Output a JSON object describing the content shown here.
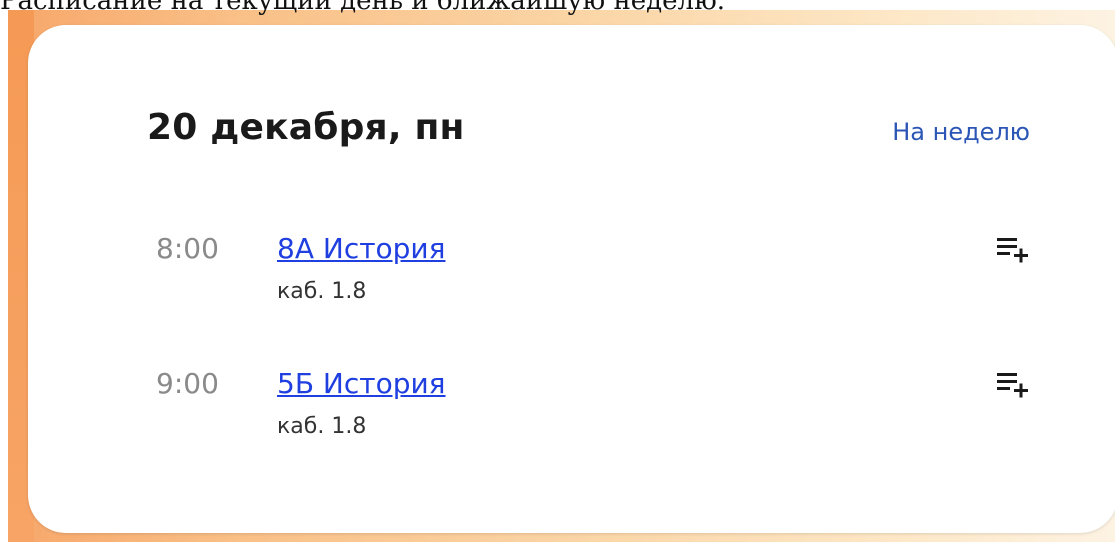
{
  "caption": "Расписание на текущий день и ближайшую неделю.",
  "schedule": {
    "date": "20 декабря, пн",
    "week_link": "На неделю",
    "lessons": [
      {
        "time": "8:00",
        "subject": "8А История",
        "room": "каб. 1.8",
        "add_icon": "playlist-add-icon"
      },
      {
        "time": "9:00",
        "subject": "5Б История",
        "room": "каб. 1.8",
        "add_icon": "playlist-add-icon"
      }
    ]
  },
  "colors": {
    "link": "#2b56b5",
    "subject_link": "#1f3fe0",
    "time": "#8a8a8a",
    "backdrop_orange": "#f7a76a"
  }
}
